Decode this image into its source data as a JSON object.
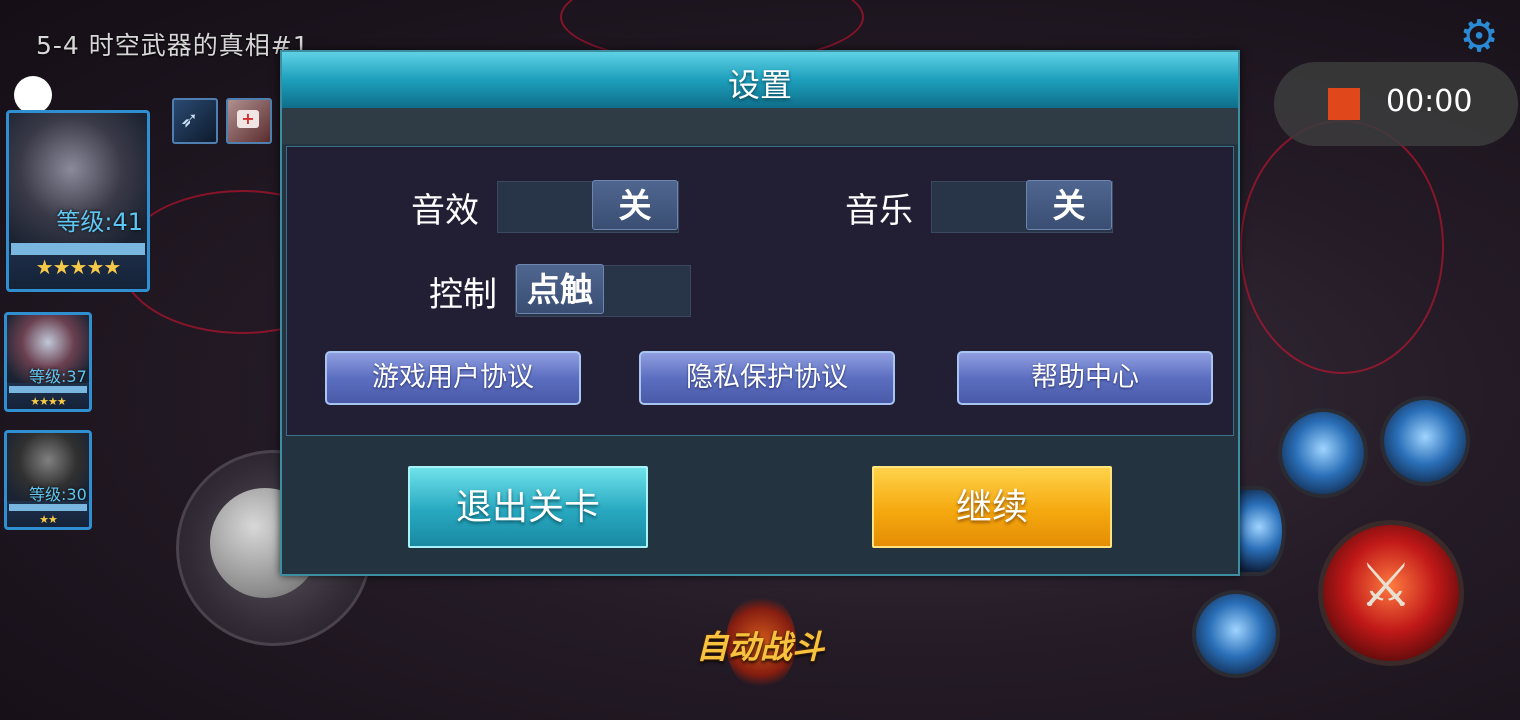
{
  "hud": {
    "level_title": "5-4  时空武器的真相#1",
    "heroes": [
      {
        "level": "等级:41",
        "stars": "★★★★★"
      },
      {
        "level": "等级:37",
        "stars": "★★★★"
      },
      {
        "level": "等级:30",
        "stars": "★★"
      }
    ],
    "auto_battle": "自动战斗"
  },
  "recorder": {
    "time": "00:00",
    "stop_color": "#e0481c"
  },
  "settings": {
    "title": "设置",
    "sound_label": "音效",
    "sound_value": "关",
    "music_label": "音乐",
    "music_value": "关",
    "control_label": "控制",
    "control_value": "点触",
    "links": [
      "游戏用户协议",
      "隐私保护协议",
      "帮助中心"
    ],
    "exit_label": "退出关卡",
    "continue_label": "继续"
  },
  "colors": {
    "exit_button": "#27a8c0",
    "continue_button": "#f5a90f",
    "header": "#1d9fbb",
    "link_button": "#5c6ec0"
  }
}
